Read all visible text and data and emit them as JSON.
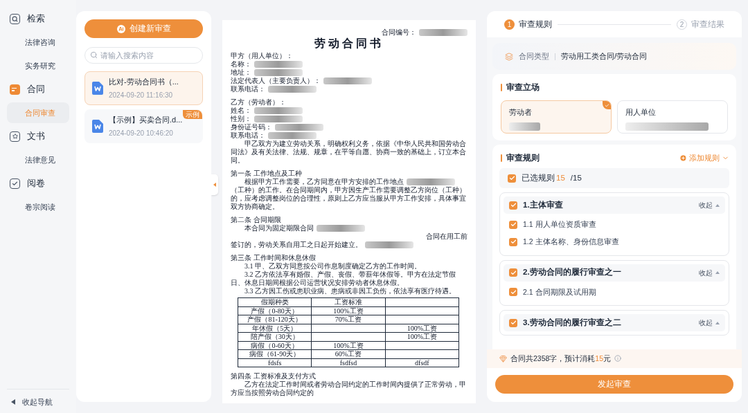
{
  "nav": {
    "sections": [
      {
        "label": "检索",
        "children": [
          {
            "label": "法律咨询",
            "selected": false
          },
          {
            "label": "实务研究",
            "selected": false
          }
        ]
      },
      {
        "label": "合同",
        "children": [
          {
            "label": "合同审查",
            "selected": true
          }
        ]
      },
      {
        "label": "文书",
        "children": [
          {
            "label": "法律意见",
            "selected": false
          }
        ]
      },
      {
        "label": "阅卷",
        "children": [
          {
            "label": "卷宗阅读",
            "selected": false
          }
        ]
      }
    ],
    "collapse": "收起导航"
  },
  "review_list": {
    "create_button": "创建新审查",
    "search": {
      "placeholder": "请输入搜索内容"
    },
    "items": [
      {
        "title": "比对-劳动合同书（...",
        "time": "2024-09-20 11:16:30",
        "selected": true
      },
      {
        "title": "【示例】买卖合同.d...",
        "time": "2024-09-20 10:46:20",
        "selected": false,
        "badge": "示例"
      }
    ]
  },
  "document": {
    "blocks": [
      {
        "kind": "number",
        "text": "合同编号：",
        "redacted": true
      },
      {
        "kind": "title",
        "text": "劳动合同书"
      },
      {
        "kind": "line",
        "text": "甲方（用人单位）："
      },
      {
        "kind": "line",
        "text": "名称：",
        "redacted": true
      },
      {
        "kind": "line",
        "text": "地址：",
        "redacted": true
      },
      {
        "kind": "line",
        "text": "法定代表人（主要负责人）：",
        "redacted": true
      },
      {
        "kind": "line",
        "text": "联系电话：",
        "redacted": true
      },
      {
        "kind": "section",
        "text": "乙方（劳动者）："
      },
      {
        "kind": "line",
        "text": "姓名：",
        "redacted": true
      },
      {
        "kind": "line",
        "text": "性别：",
        "redacted": true
      },
      {
        "kind": "line",
        "text": "身份证号码：",
        "redacted": true
      },
      {
        "kind": "line",
        "text": "联系电话：",
        "redacted": true
      },
      {
        "kind": "para",
        "text": "甲乙双方为建立劳动关系，明确权利义务，依据《中华人民共和国劳动合同法》及有关法律、法规、规章，在平等自愿、协商一致的基础上，订立本合同。"
      },
      {
        "kind": "section",
        "text": "第一条  工作地点及工种"
      },
      {
        "kind": "para",
        "text": "根据甲方工作需要，乙方同意在甲方安排的工作地点",
        "redacted": true
      },
      {
        "kind": "line",
        "text": "（工种）的工作。在合同期间内，甲方因生产工作需要调整乙方岗位（工种）的，应考虑调整岗位的合理性，原则上乙方应当服从甲方工作安排，具体事宜双方协商确定。"
      },
      {
        "kind": "section",
        "text": "第二条  合同期限"
      },
      {
        "kind": "para",
        "text": "本合同为固定期限合同",
        "redacted": true
      },
      {
        "kind": "right",
        "text": "合同在用工前"
      },
      {
        "kind": "line",
        "text": "签订的，劳动关系自用工之日起开始建立。",
        "redacted": true
      },
      {
        "kind": "section",
        "text": "第三条  工作时间和休息休假"
      },
      {
        "kind": "para",
        "text": "3.1 甲、乙双方同意按公司作息制度确定乙方的工作时间。"
      },
      {
        "kind": "para",
        "text": "3.2 乙方依法享有婚假、产假、丧假、带薪年休假等。甲方在法定节假日、休息日期间根据公司运营状况安排劳动者休息休假。"
      },
      {
        "kind": "para",
        "text": "3.3 乙方因工伤或患职业病、患病或非因工负伤，依法享有医疗待遇。"
      },
      {
        "kind": "table",
        "rows": [
          {
            "column_1": "假期种类",
            "column_2": "工资标准"
          },
          {
            "column_1": "产假（0-80天）",
            "column_2": "100%工资"
          },
          {
            "column_1": "产假（81-120天）",
            "column_2": "70%工资"
          },
          {
            "column_1": "年休假（5天）",
            "column_3": "100%工资"
          },
          {
            "column_1": "陪产假（30天）",
            "column_3": "100%工资"
          },
          {
            "column_1": "病假（0-60天）",
            "column_2": "100%工资"
          },
          {
            "column_1": "病假（61-90天）",
            "column_2": "60%工资"
          },
          {
            "column_1": "fdsfs",
            "column_2": "fsdfsd",
            "column_3": "dfsdf"
          }
        ]
      },
      {
        "kind": "section",
        "text": "第四条  工资标准及支付方式"
      },
      {
        "kind": "para",
        "text": "乙方在法定工作时间或者劳动合同约定的工作时间内提供了正常劳动，甲方应当按照劳动合同约定的"
      }
    ]
  },
  "review": {
    "steps": [
      {
        "number": "1",
        "label": "审查规则",
        "selected": true
      },
      {
        "number": "2",
        "label": "审查结果",
        "selected": false
      }
    ],
    "contract_type": {
      "label": "合同类型",
      "value": "劳动用工类合同/劳动合同"
    },
    "stance": {
      "title": "审查立场",
      "options": [
        {
          "label": "劳动者",
          "selected": true
        },
        {
          "label": "用人单位",
          "selected": false
        }
      ]
    },
    "rules": {
      "title": "审查规则",
      "add": "添加规则",
      "summary": {
        "label": "已选规则",
        "count": "15",
        "total": "/15",
        "checked": true
      },
      "groups": [
        {
          "title": "1.主体审查",
          "checked": true,
          "toggle": "收起",
          "expanded": true,
          "children": [
            {
              "label": "1.1 用人单位资质审查",
              "checked": true
            },
            {
              "label": "1.2 主体名称、身份信息审查",
              "checked": true
            }
          ]
        },
        {
          "title": "2.劳动合同的履行审查之一",
          "checked": true,
          "toggle": "收起",
          "expanded": true,
          "children": [
            {
              "label": "2.1 合同期限及试用期",
              "checked": true
            }
          ]
        },
        {
          "title": "3.劳动合同的履行审查之二",
          "checked": true,
          "toggle": "收起",
          "expanded": true
        }
      ]
    },
    "cost": {
      "prefix": "合同共2358字，预计消耗",
      "amount": "15",
      "suffix": "元"
    },
    "submit": "发起审查"
  }
}
